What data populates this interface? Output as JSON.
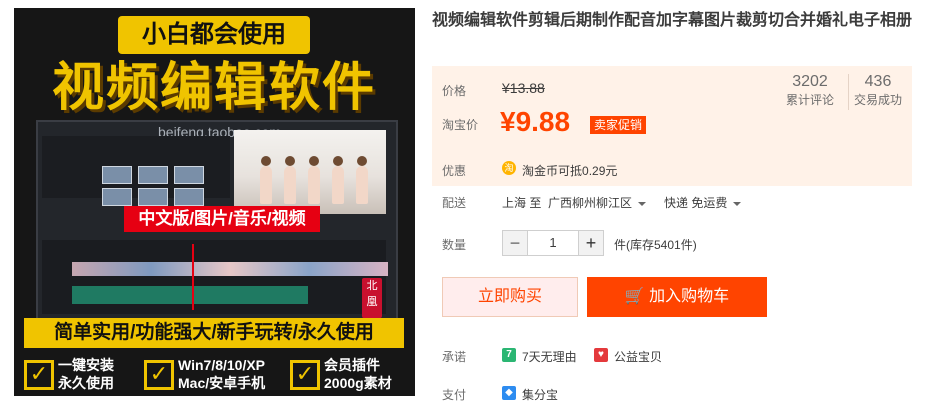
{
  "image": {
    "badge": "小白都会使用",
    "headline": "视频编辑软件",
    "watermark": "beifeng.taobao.com",
    "banner": "中文版/图片/音乐/视频",
    "seal": "北凰",
    "slogan": "简单实用/功能强大/新手玩转/永久使用",
    "features": [
      {
        "line1": "一键安装",
        "line2": "永久使用"
      },
      {
        "line1": "Win7/8/10/XP",
        "line2": "Mac/安卓手机"
      },
      {
        "line1": "会员插件",
        "line2": "2000g素材"
      }
    ]
  },
  "product": {
    "title": "视频编辑软件剪辑后期制作配音加字幕图片裁剪切合并婚礼电子相册"
  },
  "price": {
    "label": "价格",
    "original": "¥13.88",
    "taobao_label": "淘宝价",
    "sale": "¥9.88",
    "promo_tag": "卖家促销"
  },
  "stats": [
    {
      "value": "3202",
      "label": "累计评论"
    },
    {
      "value": "436",
      "label": "交易成功"
    }
  ],
  "promotion": {
    "label": "优惠",
    "coin_icon": "淘",
    "text_prefix": "淘金币可抵",
    "amount": "0.29",
    "unit": "元"
  },
  "shipping": {
    "label": "配送",
    "from": "上海",
    "to_word": "至",
    "destination": "广西柳州柳江区",
    "method": "快递 免运费"
  },
  "quantity": {
    "label": "数量",
    "minus": "−",
    "value": "1",
    "plus": "+",
    "unit": "件(库存5401件)"
  },
  "actions": {
    "buy_now": "立即购买",
    "add_to_cart": "加入购物车"
  },
  "guarantee": {
    "label": "承诺",
    "items": [
      {
        "icon": "7",
        "text": "7天无理由"
      },
      {
        "icon": "♥",
        "text": "公益宝贝"
      }
    ]
  },
  "payment": {
    "label": "支付",
    "text": "集分宝"
  },
  "colors": {
    "accent": "#ff4400",
    "price_bg": "#fff2e8",
    "brand_yellow": "#f0c400"
  }
}
